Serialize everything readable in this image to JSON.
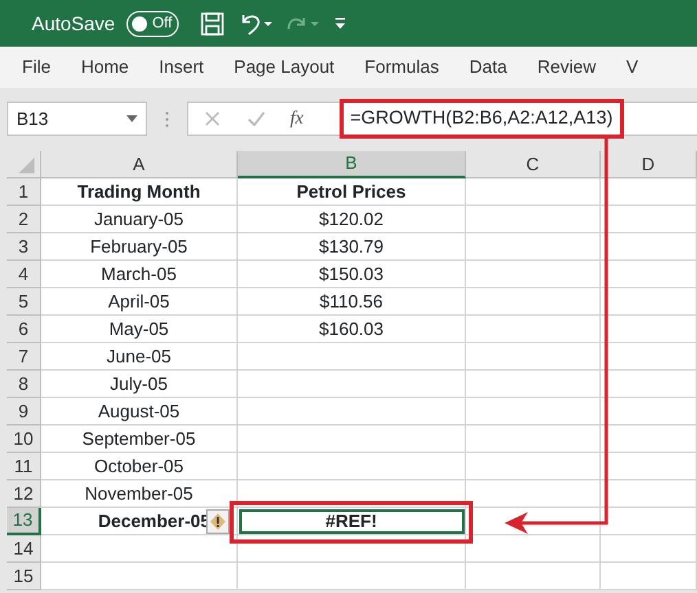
{
  "title_bar": {
    "autosave_label": "AutoSave",
    "autosave_toggle": {
      "text": "Off",
      "on": false
    }
  },
  "ribbon_tabs": [
    "File",
    "Home",
    "Insert",
    "Page Layout",
    "Formulas",
    "Data",
    "Review",
    "V"
  ],
  "formula_bar": {
    "name_box": "B13",
    "function_label": "fx",
    "formula": "=GROWTH(B2:B6,A2:A12,A13)"
  },
  "columns": [
    {
      "label": "A",
      "selected": false
    },
    {
      "label": "B",
      "selected": true
    },
    {
      "label": "C",
      "selected": false
    },
    {
      "label": "D",
      "selected": false
    }
  ],
  "rows": [
    {
      "number": "1",
      "kind": "header",
      "selected": false,
      "cells": [
        "Trading Month",
        "Petrol Prices"
      ]
    },
    {
      "number": "2",
      "kind": "data",
      "selected": false,
      "cells": [
        "January-05",
        "$120.02"
      ]
    },
    {
      "number": "3",
      "kind": "data",
      "selected": false,
      "cells": [
        "February-05",
        "$130.79"
      ]
    },
    {
      "number": "4",
      "kind": "data",
      "selected": false,
      "cells": [
        "March-05",
        "$150.03"
      ]
    },
    {
      "number": "5",
      "kind": "data",
      "selected": false,
      "cells": [
        "April-05",
        "$110.56"
      ]
    },
    {
      "number": "6",
      "kind": "data",
      "selected": false,
      "cells": [
        "May-05",
        "$160.03"
      ]
    },
    {
      "number": "7",
      "kind": "data",
      "selected": false,
      "cells": [
        "June-05"
      ]
    },
    {
      "number": "8",
      "kind": "data",
      "selected": false,
      "cells": [
        "July-05"
      ]
    },
    {
      "number": "9",
      "kind": "data",
      "selected": false,
      "cells": [
        "August-05"
      ]
    },
    {
      "number": "10",
      "kind": "data",
      "selected": false,
      "cells": [
        "September-05"
      ]
    },
    {
      "number": "11",
      "kind": "data",
      "selected": false,
      "cells": [
        "October-05"
      ]
    },
    {
      "number": "12",
      "kind": "data",
      "selected": false,
      "cells": [
        "November-05"
      ]
    },
    {
      "number": "13",
      "kind": "error",
      "selected": true,
      "cells": [
        "December-05",
        "#REF!"
      ]
    },
    {
      "number": "14",
      "selected": false,
      "cells": []
    },
    {
      "number": "15",
      "selected": false,
      "cells": []
    }
  ]
}
